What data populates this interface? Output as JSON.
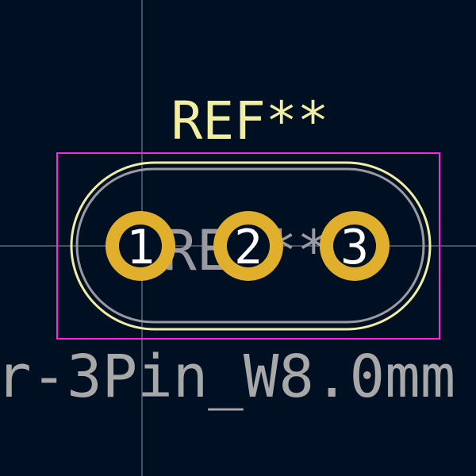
{
  "colors": {
    "background": "#001023",
    "crosshair": "#c8c8d0",
    "courtyard": "#ff26e2",
    "silkscreen": "#f2eda1",
    "fabrication": "#9a9aa0",
    "pad": "#e0b02c",
    "pad_number": "#ffffff",
    "value_text": "#a8a8a8"
  },
  "footprint": {
    "reference_label": "REF**",
    "fab_reference_label": "REF**",
    "value_label": "r-3Pin_W8.0mm",
    "pads": [
      {
        "number": "1"
      },
      {
        "number": "2"
      },
      {
        "number": "3"
      }
    ]
  }
}
